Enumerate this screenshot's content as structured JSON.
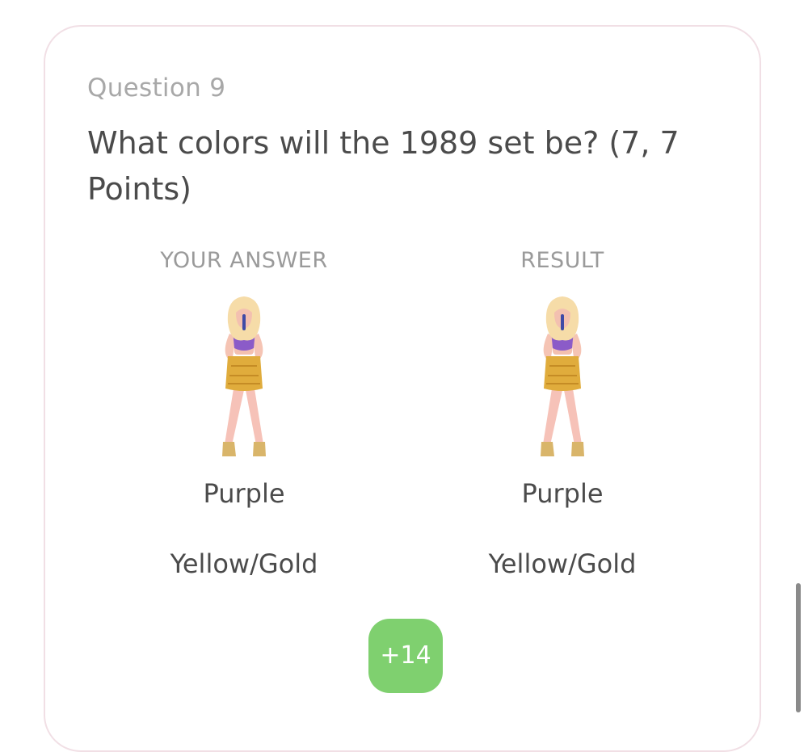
{
  "question": {
    "number_label": "Question 9",
    "title": "What colors will the 1989 set be? (7, 7 Points)"
  },
  "your_answer": {
    "header": "YOUR ANSWER",
    "image_icon": "performer-outfit-purple-gold-icon",
    "lines": [
      "Purple",
      "Yellow/Gold"
    ]
  },
  "result": {
    "header": "RESULT",
    "image_icon": "performer-outfit-purple-gold-icon",
    "lines": [
      "Purple",
      "Yellow/Gold"
    ]
  },
  "points": {
    "label": "+14",
    "color": "#7fd06f"
  },
  "colors": {
    "card_border": "#f1dfe5",
    "title_text": "#4b4b4b",
    "muted_text": "#a8a8a8"
  }
}
